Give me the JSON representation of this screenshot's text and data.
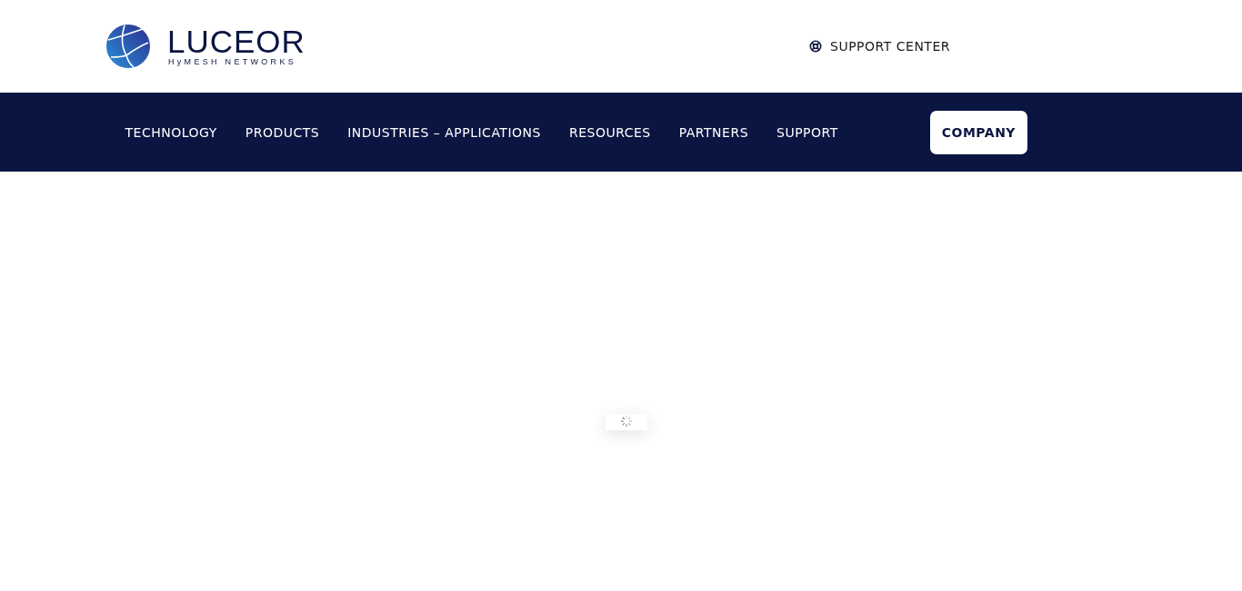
{
  "logo": {
    "wordmark": "LUCEOR",
    "tagline": "HyMESH NETWORKS"
  },
  "support_link": {
    "label": "SUPPORT CENTER"
  },
  "nav": [
    {
      "label": "TECHNOLOGY",
      "selected": false
    },
    {
      "label": "PRODUCTS",
      "selected": false
    },
    {
      "label": "INDUSTRIES – APPLICATIONS",
      "selected": false
    },
    {
      "label": "RESOURCES",
      "selected": false
    },
    {
      "label": "PARTNERS",
      "selected": false
    },
    {
      "label": "SUPPORT",
      "selected": false
    },
    {
      "label": "COMPANY",
      "selected": true
    }
  ]
}
